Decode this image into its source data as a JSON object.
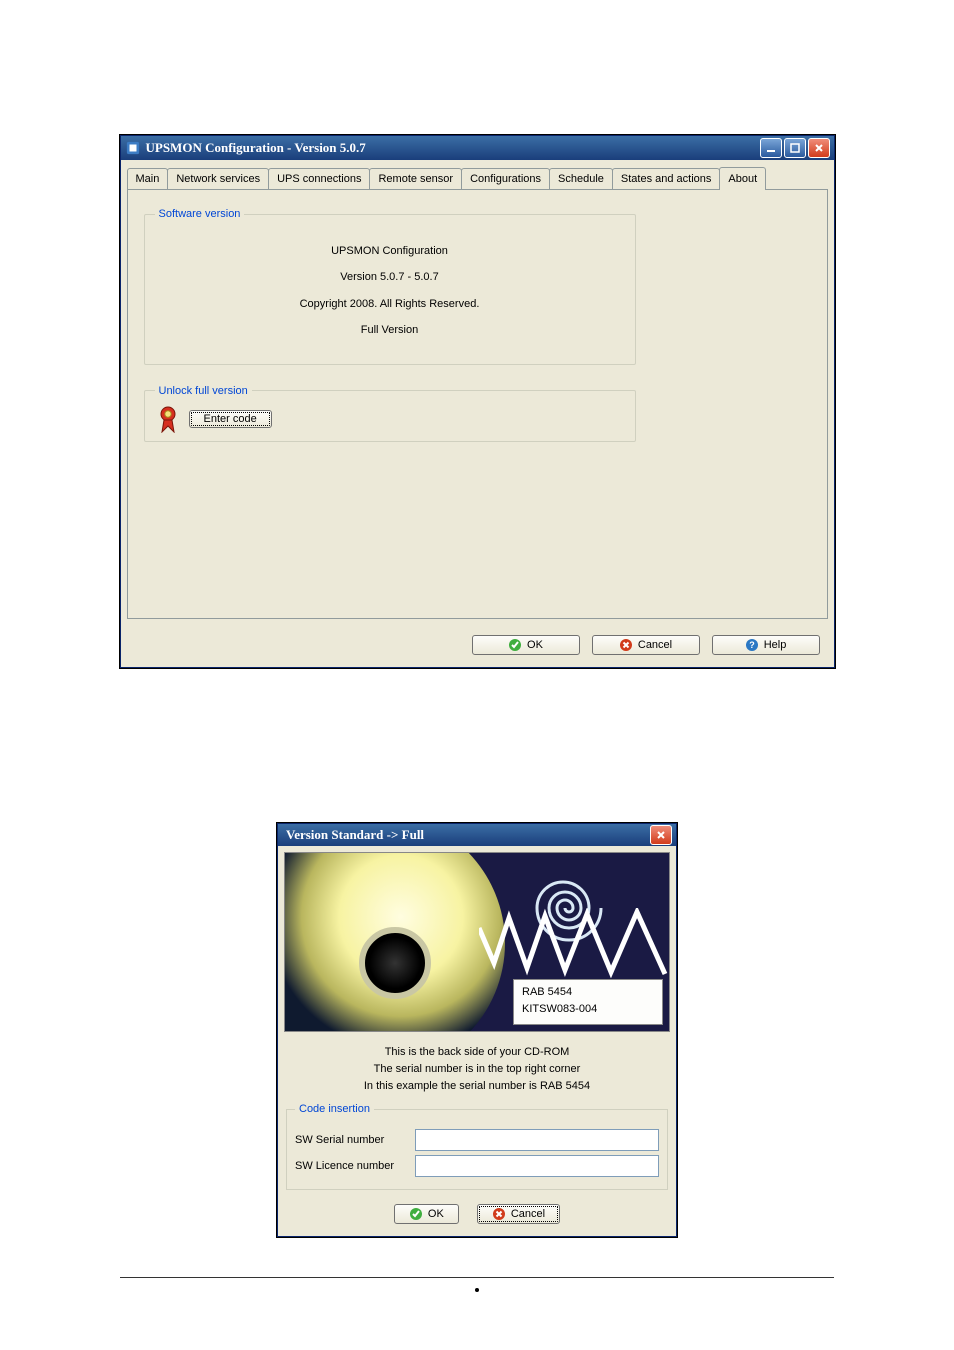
{
  "window1": {
    "title": "UPSMON Configuration - Version 5.0.7",
    "tabs": [
      "Main",
      "Network services",
      "UPS connections",
      "Remote sensor",
      "Configurations",
      "Schedule",
      "States and actions",
      "About"
    ],
    "activeTab": 7,
    "softwareVersion": {
      "legend": "Software version",
      "line1": "UPSMON Configuration",
      "line2": "Version 5.0.7 - 5.0.7",
      "line3": "Copyright 2008. All Rights Reserved.",
      "line4": "Full Version"
    },
    "unlock": {
      "legend": "Unlock full version",
      "button": "Enter code"
    },
    "footer": {
      "ok": "OK",
      "cancel": "Cancel",
      "help": "Help"
    }
  },
  "window2": {
    "title": "Version Standard -> Full",
    "serial1": "RAB 5454",
    "serial2": "KITSW083-004",
    "desc1": "This is the back side of your CD-ROM",
    "desc2": "The serial number is in the top right corner",
    "desc3": "In this example the serial number is RAB 5454",
    "group": {
      "legend": "Code insertion",
      "serialLabel": "SW Serial number",
      "licenceLabel": "SW Licence number",
      "serialValue": "",
      "licenceValue": ""
    },
    "footer": {
      "ok": "OK",
      "cancel": "Cancel"
    }
  },
  "icons": {
    "ok": "ok-icon",
    "cancel": "cancel-icon",
    "help": "help-icon",
    "min": "minimize-icon",
    "max": "maximize-icon",
    "close": "close-icon",
    "app": "app-icon",
    "ribbon": "ribbon-icon"
  }
}
